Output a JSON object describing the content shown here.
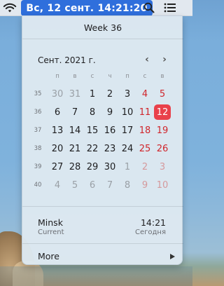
{
  "menubar": {
    "clock_text": "Вс, 12 сент.  14:21:20"
  },
  "popover": {
    "week_title": "Week 36",
    "month_title": "Сент. 2021 г.",
    "prev_label": "‹",
    "next_label": "›",
    "weekdays": [
      "п",
      "в",
      "с",
      "ч",
      "п",
      "с",
      "в"
    ],
    "weeks": [
      {
        "num": "35",
        "days": [
          {
            "d": "30",
            "other": true
          },
          {
            "d": "31",
            "other": true
          },
          {
            "d": "1"
          },
          {
            "d": "2"
          },
          {
            "d": "3"
          },
          {
            "d": "4",
            "weekend": true
          },
          {
            "d": "5",
            "weekend": true
          }
        ]
      },
      {
        "num": "36",
        "days": [
          {
            "d": "6"
          },
          {
            "d": "7"
          },
          {
            "d": "8"
          },
          {
            "d": "9"
          },
          {
            "d": "10"
          },
          {
            "d": "11",
            "weekend": true
          },
          {
            "d": "12",
            "weekend": true,
            "today": true
          }
        ]
      },
      {
        "num": "37",
        "days": [
          {
            "d": "13"
          },
          {
            "d": "14"
          },
          {
            "d": "15"
          },
          {
            "d": "16"
          },
          {
            "d": "17"
          },
          {
            "d": "18",
            "weekend": true
          },
          {
            "d": "19",
            "weekend": true
          }
        ]
      },
      {
        "num": "38",
        "days": [
          {
            "d": "20"
          },
          {
            "d": "21"
          },
          {
            "d": "22"
          },
          {
            "d": "23"
          },
          {
            "d": "24"
          },
          {
            "d": "25",
            "weekend": true
          },
          {
            "d": "26",
            "weekend": true
          }
        ]
      },
      {
        "num": "39",
        "days": [
          {
            "d": "27"
          },
          {
            "d": "28"
          },
          {
            "d": "29"
          },
          {
            "d": "30"
          },
          {
            "d": "1",
            "other": true
          },
          {
            "d": "2",
            "other": true,
            "weekend": true
          },
          {
            "d": "3",
            "other": true,
            "weekend": true
          }
        ]
      },
      {
        "num": "40",
        "days": [
          {
            "d": "4",
            "other": true
          },
          {
            "d": "5",
            "other": true
          },
          {
            "d": "6",
            "other": true
          },
          {
            "d": "7",
            "other": true
          },
          {
            "d": "8",
            "other": true
          },
          {
            "d": "9",
            "other": true,
            "weekend": true
          },
          {
            "d": "10",
            "other": true,
            "weekend": true
          }
        ]
      }
    ],
    "city": {
      "name": "Minsk",
      "sub": "Current",
      "time": "14:21",
      "day": "Сегодня"
    },
    "more_label": "More"
  },
  "colors": {
    "today_bg": "#e9414b",
    "weekend": "#d0262c",
    "menubar_highlight": "#2f6fdc"
  },
  "icons": {
    "menubar": [
      "wifi-icon",
      "search-icon",
      "control-center-icon"
    ],
    "more": "triangle-right-icon"
  }
}
